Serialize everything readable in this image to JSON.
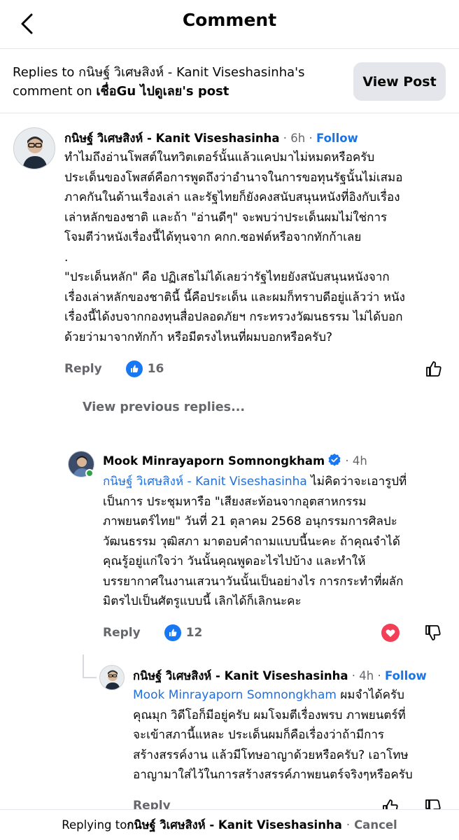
{
  "header": {
    "title": "Comment"
  },
  "context": {
    "prefix": "Replies to กนิษฐ์ วิเศษสิงห์ - Kanit Viseshasinha's comment on ",
    "page_name": "เชื่อGu ไปดูเลย",
    "suffix": "'s post",
    "view_post_label": "View Post"
  },
  "comment1": {
    "author": "กนิษฐ์ วิเศษสิงห์ - Kanit Viseshasinha",
    "time": "6h",
    "follow": "Follow",
    "lines": [
      "ทำไมถึงอ่านโพสต์ในทวิตเตอร์นั้นแล้วแคปมาไม่หมดหรือครับ",
      "ประเด็นของโพสต์คือการพูดถึงว่าอำนาจในการขอทุนรัฐนั้นไม่เสมอ",
      "ภาคกันในด้านเรื่องเล่า และรัฐไทยก็ยังคงสนับสนุนหนังที่อิงกับเรื่อง",
      "เล่าหลักของชาติ และถ้า \"อ่านดีๆ\" จะพบว่าประเด็นผมไม่ใช่การ",
      "โจมตีว่าหนังเรื่องนี้ได้ทุนจาก คกก.ซอฟต์หรือจากทักก้าเลย",
      ".",
      "\"ประเด็นหลัก\" คือ ปฏิเสธไม่ได้เลยว่ารัฐไทยยังสนับสนุนหนังจาก",
      "เรื่องเล่าหลักของชาตินี้ นี้คือประเด็น และผมก็ทราบดีอยู่แล้วว่า หนัง",
      "เรื่องนี้ได้งบจากกองทุนสื่อปลอดภัยฯ กระทรวงวัฒนธรรม ไม่ได้บอก",
      "ด้วยว่ามาจากทักก้า หรือมีตรงไหนที่ผมบอกหรือครับ?"
    ],
    "reply_label": "Reply",
    "like_count": "16"
  },
  "view_previous": "View previous replies...",
  "comment2": {
    "author": "Mook Minrayaporn Somnongkham",
    "time": "4h",
    "mention": "กนิษฐ์ วิเศษสิงห์ - Kanit Viseshasinha",
    "first_rest": " ไม่คิดว่าจะเอารูปที่",
    "lines": [
      "เป็นการ ประชุมหารือ \"เสียงสะท้อนจากอุตสาหกรรม",
      "ภาพยนตร์ไทย\" วันที่ 21 ตุลาคม 2568 อนุกรรมการศิลปะ",
      "วัฒนธรรม วุฒิสภา มาตอบคำถามแบบนี้นะคะ ถ้าคุณจำได้",
      "คุณรู้อยู่แก่ใจว่า วันนั้นคุณพูดอะไรไปบ้าง และทำให้",
      "บรรยากาศในงานเสวนาวันนั้นเป็นอย่างไร  การกระทำที่ผลัก",
      "มิตรไปเป็นศัตรูแบบนี้ เลิกได้ก็เลิกนะคะ"
    ],
    "reply_label": "Reply",
    "like_count": "12"
  },
  "comment3": {
    "author": "กนิษฐ์ วิเศษสิงห์ - Kanit Viseshasinha",
    "time": "4h",
    "follow": "Follow",
    "mention": "Mook Minrayaporn Somnongkham",
    "first_rest": " ผมจำได้ครับ",
    "lines": [
      "คุณมุก วิดีโอก็มีอยู่ครับ ผมโจมตีเรื่องพรบ ภาพยนตร์ที่",
      "จะเข้าสภานี้แหละ ประเด็นผมก็คือเรื่องว่าถ้ามีการ",
      "สร้างสรรค์งาน แล้วมีโทษอาญาด้วยหรือครับ? เอาโทษ",
      "อาญามาใส่ไว้ในการสร้างสรรค์ภาพยนตร์จริงๆหรือครับ"
    ],
    "reply_label": "Reply"
  },
  "reply_bar": {
    "prefix": "Replying to ",
    "name": "กนิษฐ์ วิเศษสิงห์ - Kanit Viseshasinha",
    "separator": "·",
    "cancel": "Cancel"
  },
  "colors": {
    "link": "#216fdb",
    "follow": "#1b74e4",
    "like": "#1877f2",
    "heart": "#f33e58",
    "muted": "#65676b"
  },
  "icons": [
    "back-arrow-icon",
    "like-badge-icon",
    "thumbs-up-icon",
    "heart-icon",
    "thumbs-down-icon",
    "verified-badge-icon"
  ]
}
